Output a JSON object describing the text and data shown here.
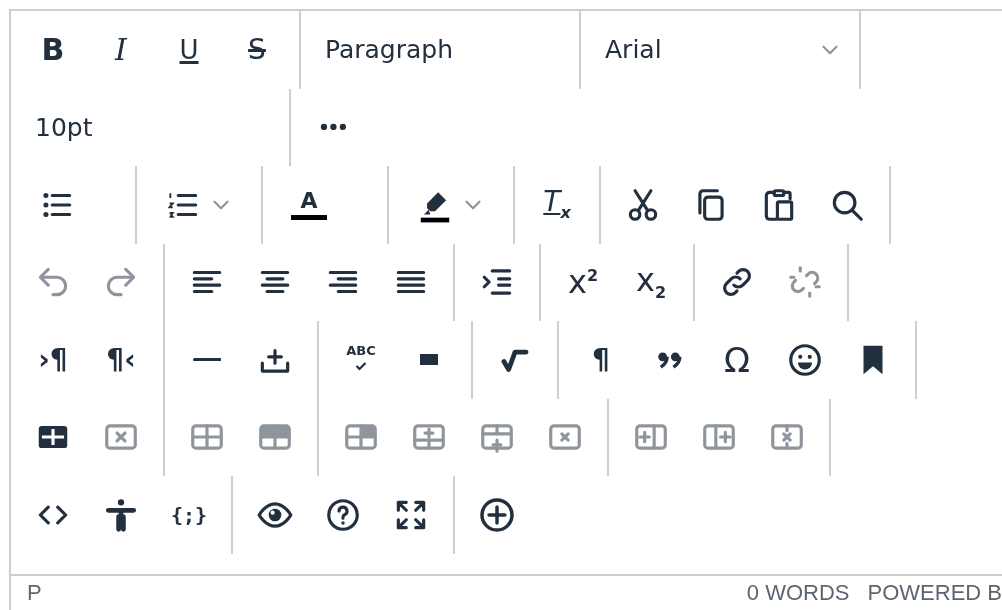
{
  "toolbar": {
    "rows": [
      {
        "groups": [
          {
            "items": [
              {
                "kind": "button",
                "text": "B",
                "disabled": false
              },
              {
                "kind": "button",
                "text": "I",
                "disabled": false
              },
              {
                "kind": "button",
                "text": "U",
                "disabled": false
              },
              {
                "kind": "button",
                "text": "S",
                "disabled": false
              }
            ]
          },
          {
            "items": [
              {
                "kind": "select",
                "text": "Paragraph",
                "caret": false
              }
            ]
          },
          {
            "items": [
              {
                "kind": "select",
                "text": "Arial",
                "caret": true
              }
            ]
          }
        ]
      },
      {
        "groups": [
          {
            "items": [
              {
                "kind": "select",
                "text": "10pt",
                "caret": false
              }
            ]
          },
          {
            "items": [
              {
                "kind": "button",
                "disabled": false
              }
            ]
          }
        ]
      },
      {
        "groups": [
          {
            "items": [
              {
                "kind": "split",
                "disabled": false,
                "caret": false
              }
            ]
          },
          {
            "items": [
              {
                "kind": "split",
                "disabled": false,
                "caret": true
              }
            ]
          },
          {
            "items": [
              {
                "kind": "split",
                "text": "A",
                "disabled": false,
                "caret": false
              }
            ]
          },
          {
            "items": [
              {
                "kind": "split",
                "disabled": false,
                "caret": true
              }
            ]
          },
          {
            "items": [
              {
                "kind": "button",
                "text": "T$_{x}$",
                "disabled": false
              }
            ]
          },
          {
            "items": [
              {
                "kind": "button",
                "disabled": false
              },
              {
                "kind": "button",
                "disabled": false
              },
              {
                "kind": "button",
                "disabled": false
              },
              {
                "kind": "button",
                "disabled": false
              }
            ]
          }
        ]
      },
      {
        "groups": [
          {
            "items": [
              {
                "kind": "button",
                "disabled": true
              },
              {
                "kind": "button",
                "disabled": true
              }
            ]
          },
          {
            "items": [
              {
                "kind": "button",
                "disabled": false
              },
              {
                "kind": "button",
                "disabled": false
              },
              {
                "kind": "button",
                "disabled": false
              },
              {
                "kind": "button",
                "disabled": false
              }
            ]
          },
          {
            "items": [
              {
                "kind": "button",
                "disabled": false
              }
            ]
          },
          {
            "items": [
              {
                "kind": "button",
                "text": "x$^{2}$",
                "disabled": false
              },
              {
                "kind": "button",
                "text": "x$_{2}$",
                "disabled": false
              }
            ]
          },
          {
            "items": [
              {
                "kind": "button",
                "disabled": false
              },
              {
                "kind": "button",
                "disabled": true
              }
            ]
          }
        ]
      },
      {
        "groups": [
          {
            "items": [
              {
                "kind": "button",
                "text": "›¶",
                "disabled": false
              },
              {
                "kind": "button",
                "text": "¶‹",
                "disabled": false
              }
            ]
          },
          {
            "items": [
              {
                "kind": "button",
                "disabled": false
              },
              {
                "kind": "button",
                "disabled": false
              }
            ]
          },
          {
            "items": [
              {
                "kind": "button",
                "text": "ABC",
                "disabled": false
              },
              {
                "kind": "button",
                "disabled": false
              }
            ]
          },
          {
            "items": [
              {
                "kind": "button",
                "disabled": false
              }
            ]
          },
          {
            "items": [
              {
                "kind": "button",
                "text": "¶",
                "disabled": false
              },
              {
                "kind": "button",
                "disabled": false
              },
              {
                "kind": "button",
                "text": "Ω",
                "disabled": false
              },
              {
                "kind": "button",
                "disabled": false
              },
              {
                "kind": "button",
                "disabled": false
              }
            ]
          }
        ]
      },
      {
        "groups": [
          {
            "items": [
              {
                "kind": "button",
                "disabled": false
              },
              {
                "kind": "button",
                "disabled": true
              }
            ]
          },
          {
            "items": [
              {
                "kind": "button",
                "disabled": true
              },
              {
                "kind": "button",
                "disabled": true
              }
            ]
          },
          {
            "items": [
              {
                "kind": "button",
                "disabled": true
              },
              {
                "kind": "button",
                "disabled": true
              },
              {
                "kind": "button",
                "disabled": true
              },
              {
                "kind": "button",
                "disabled": true
              }
            ]
          },
          {
            "items": [
              {
                "kind": "button",
                "disabled": true
              },
              {
                "kind": "button",
                "disabled": true
              },
              {
                "kind": "button",
                "disabled": true
              }
            ]
          }
        ]
      },
      {
        "groups": [
          {
            "items": [
              {
                "kind": "button",
                "disabled": false
              },
              {
                "kind": "button",
                "disabled": false
              },
              {
                "kind": "button",
                "text": "{;}",
                "disabled": false
              }
            ]
          },
          {
            "items": [
              {
                "kind": "button",
                "disabled": false
              },
              {
                "kind": "button",
                "disabled": false
              },
              {
                "kind": "button",
                "disabled": false
              }
            ]
          },
          {
            "items": [
              {
                "kind": "button",
                "disabled": false
              }
            ]
          }
        ]
      }
    ]
  },
  "status_bar": {
    "path": "P",
    "word_count": "0 WORDS",
    "branding": "POWERED B"
  }
}
